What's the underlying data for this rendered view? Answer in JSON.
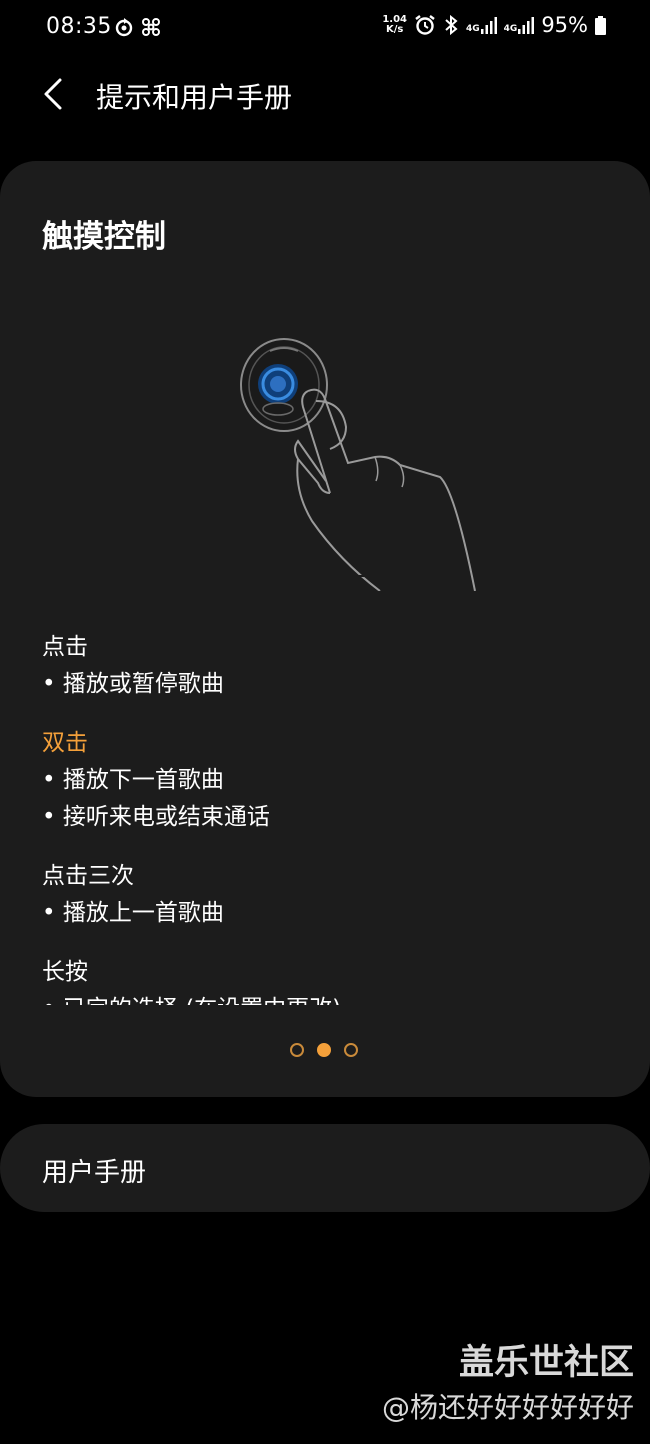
{
  "status_bar": {
    "time": "08:35",
    "net_speed_value": "1.04",
    "net_speed_unit": "K/s",
    "signal1_label": "4G",
    "signal2_label": "4G",
    "battery_percent": "95%"
  },
  "header": {
    "title": "提示和用户手册",
    "back_icon": "chevron-left-icon"
  },
  "card": {
    "title": "触摸控制",
    "illustration_icon": "earbud-touch-icon",
    "groups": [
      {
        "heading": "点击",
        "active": false,
        "items": [
          "播放或暂停歌曲"
        ]
      },
      {
        "heading": "双击",
        "active": true,
        "items": [
          "播放下一首歌曲",
          "接听来电或结束通话"
        ]
      },
      {
        "heading": "点击三次",
        "active": false,
        "items": [
          "播放上一首歌曲"
        ]
      },
      {
        "heading": "长按",
        "active": false,
        "items": [
          "已定的选择 (在设置中更改)"
        ]
      }
    ],
    "pager": {
      "count": 3,
      "active_index": 1
    }
  },
  "manual": {
    "label": "用户手册"
  },
  "watermark": {
    "brand": "盖乐世社区",
    "user": "@杨还好好好好好好"
  },
  "colors": {
    "background": "#000000",
    "card": "#1c1c1c",
    "accent": "#f4a03a",
    "text": "#ffffff"
  }
}
